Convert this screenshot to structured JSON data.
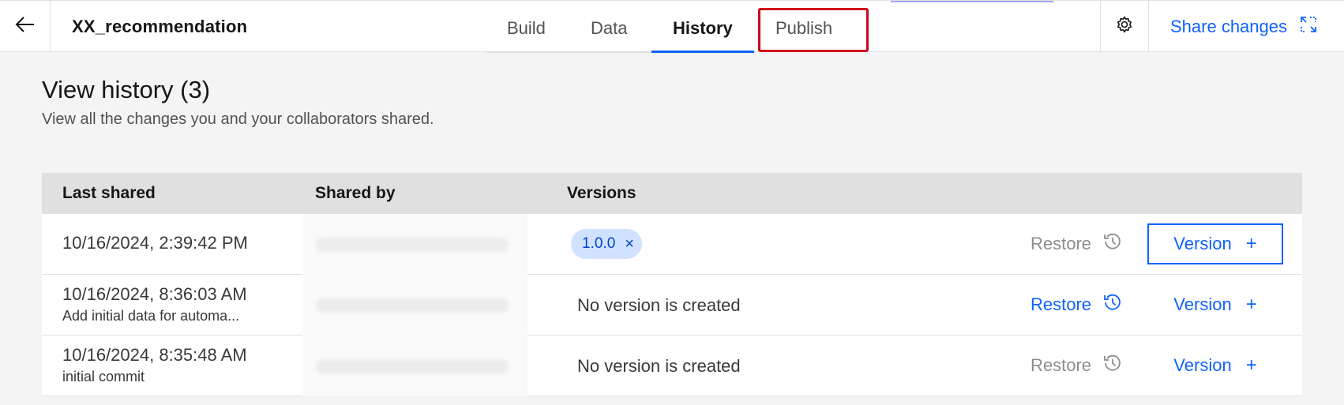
{
  "header": {
    "app_title": "XX_recommendation",
    "tabs": [
      {
        "label": "Build"
      },
      {
        "label": "Data"
      },
      {
        "label": "History"
      },
      {
        "label": "Publish"
      }
    ],
    "active_tab": "History",
    "share_label": "Share changes",
    "icons": {
      "back": "arrow-left-icon",
      "settings": "gear-icon",
      "share": "share-sync-icon"
    }
  },
  "page": {
    "title": "View history (3)",
    "subtitle": "View all the changes you and your collaborators shared."
  },
  "table": {
    "columns": [
      "Last shared",
      "Shared by",
      "Versions"
    ],
    "rows": [
      {
        "date": "10/16/2024, 2:39:42 PM",
        "note": "",
        "shared_by": "",
        "version_tag": "1.0.0",
        "version_text": "",
        "restore_label": "Restore",
        "restore_enabled": false,
        "version_button": "Version"
      },
      {
        "date": "10/16/2024, 8:36:03 AM",
        "note": "Add initial data for automa...",
        "shared_by": "",
        "version_tag": "",
        "version_text": "No version is created",
        "restore_label": "Restore",
        "restore_enabled": true,
        "version_button": "Version"
      },
      {
        "date": "10/16/2024, 8:35:48 AM",
        "note": "initial commit",
        "shared_by": "",
        "version_tag": "",
        "version_text": "No version is created",
        "restore_label": "Restore",
        "restore_enabled": false,
        "version_button": "Version"
      }
    ]
  },
  "colors": {
    "accent": "#0f62fe",
    "highlight": "#d0021b",
    "tag_bg": "#d0e2ff",
    "disabled": "#8d8d8d"
  }
}
